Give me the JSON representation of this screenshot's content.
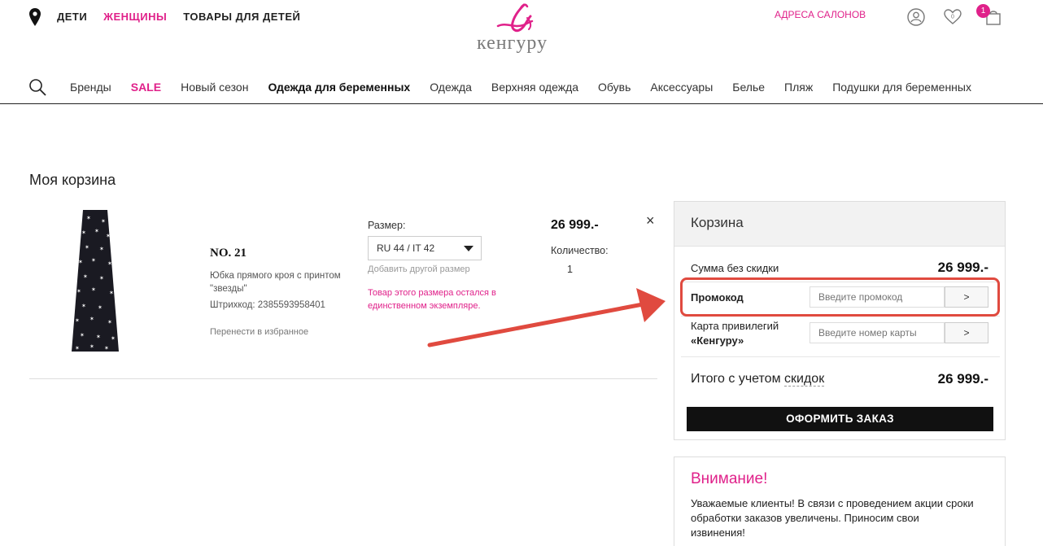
{
  "header": {
    "top_links": [
      "ДЕТИ",
      "ЖЕНЩИНЫ",
      "ТОВАРЫ ДЛЯ ДЕТЕЙ"
    ],
    "logo_text": "кенгуру",
    "salons_link": "АДРЕСА САЛОНОВ",
    "wishlist_count": "0",
    "cart_count": "1"
  },
  "menu": {
    "items": [
      "Бренды",
      "SALE",
      "Новый сезон",
      "Одежда для беременных",
      "Одежда",
      "Верхняя одежда",
      "Обувь",
      "Аксессуары",
      "Белье",
      "Пляж",
      "Подушки для беременных"
    ]
  },
  "cart": {
    "title": "Моя корзина",
    "item": {
      "name": "NO. 21",
      "description": "Юбка прямого кроя с принтом \"звезды\"",
      "barcode": "Штрихкод: 2385593958401",
      "move_to_favorites": "Перенести в избранное",
      "size_label": "Размер:",
      "size_value": "RU 44 / IT 42",
      "add_size": "Добавить другой размер",
      "stock_note": "Товар этого размера остался в единственном экземпляре.",
      "price": "26 999.-",
      "quantity_label": "Количество:",
      "quantity": "1",
      "remove": "×"
    }
  },
  "summary": {
    "title": "Корзина",
    "subtotal_label": "Сумма без скидки",
    "subtotal_value": "26 999.-",
    "promo_label": "Промокод",
    "promo_placeholder": "Введите промокод",
    "promo_button": ">",
    "card_label_line1": "Карта привилегий",
    "card_label_line2": "«Кенгуру»",
    "card_placeholder": "Введите номер карты",
    "card_button": ">",
    "total_label_prefix": "Итого с учетом ",
    "total_label_link": "скидок",
    "total_value": "26 999.-",
    "order_button": "ОФОРМИТЬ ЗАКАЗ"
  },
  "notice": {
    "title": "Внимание!",
    "text": "Уважаемые клиенты! В связи с проведением акции сроки обработки заказов увеличены. Приносим свои извинения!"
  },
  "colors": {
    "accent": "#e0218a",
    "annotation": "#e04a3f"
  }
}
